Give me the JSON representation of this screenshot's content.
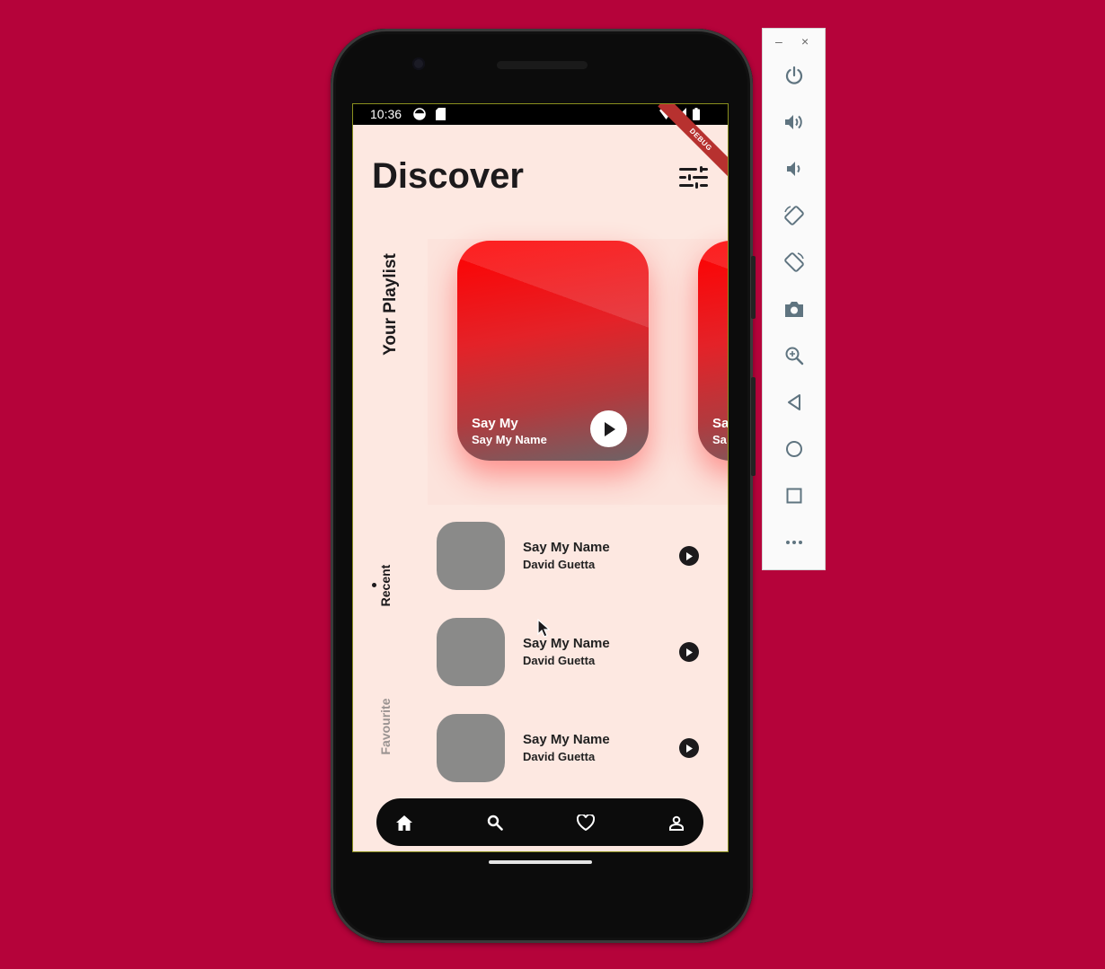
{
  "colors": {
    "background": "#b5033a",
    "screen": "#fde8e1",
    "dark": "#1c1a1c",
    "card_red": "#ff0000",
    "thumb_gray": "#8a8a89"
  },
  "status_bar": {
    "time": "10:36"
  },
  "debug_banner": "DEBUG",
  "header": {
    "title": "Discover",
    "filter_icon": "filter-sliders-icon"
  },
  "side_labels": {
    "playlist": "Your Playlist",
    "recent": "Recent",
    "favourite": "Favourite"
  },
  "playlist_cards": [
    {
      "title": "Say My",
      "subtitle": "Say My Name"
    },
    {
      "title": "Sa",
      "subtitle": "Sa"
    }
  ],
  "songs": [
    {
      "title": "Say My Name",
      "artist": "David Guetta"
    },
    {
      "title": "Say My Name",
      "artist": "David Guetta"
    },
    {
      "title": "Say My Name",
      "artist": "David Guetta"
    }
  ],
  "bottom_nav": [
    {
      "icon": "home-icon"
    },
    {
      "icon": "search-icon"
    },
    {
      "icon": "heart-icon"
    },
    {
      "icon": "profile-icon"
    }
  ],
  "emulator_panel": {
    "window_controls": [
      "–",
      "×"
    ],
    "buttons": [
      "power-icon",
      "volume-up-icon",
      "volume-down-icon",
      "rotate-left-icon",
      "rotate-right-icon",
      "camera-icon",
      "zoom-icon",
      "back-icon",
      "home-circle-icon",
      "overview-icon",
      "more-icon"
    ]
  }
}
